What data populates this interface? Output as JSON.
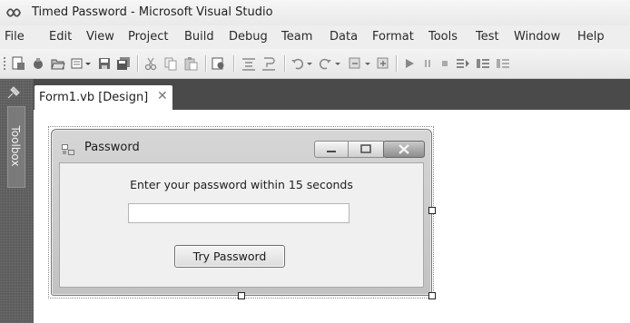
{
  "window": {
    "title": "Timed Password - Microsoft Visual Studio"
  },
  "menu": [
    "File",
    "Edit",
    "View",
    "Project",
    "Build",
    "Debug",
    "Team",
    "Data",
    "Format",
    "Tools",
    "Test",
    "Window",
    "Help"
  ],
  "toolbox": {
    "label": "Toolbox"
  },
  "document_tab": {
    "label": "Form1.vb [Design]",
    "close_glyph": "✕"
  },
  "form": {
    "title": "Password",
    "prompt": "Enter your password within 15 seconds",
    "password_value": "",
    "button_label": "Try Password"
  },
  "icons": [
    "vs-logo-icon",
    "new-project-icon",
    "add-item-icon",
    "open-file-icon",
    "save-icon",
    "save-all-icon",
    "cut-icon",
    "copy-icon",
    "paste-icon",
    "find-icon",
    "comment-icon",
    "uncomment-icon",
    "undo-icon",
    "redo-icon",
    "navigate-backward-icon",
    "navigate-forward-icon",
    "start-icon",
    "pause-icon",
    "stop-icon",
    "step-into-icon",
    "step-over-icon",
    "toolbox-pin-icon",
    "form-icon",
    "minimize-icon",
    "maximize-icon",
    "close-icon"
  ]
}
